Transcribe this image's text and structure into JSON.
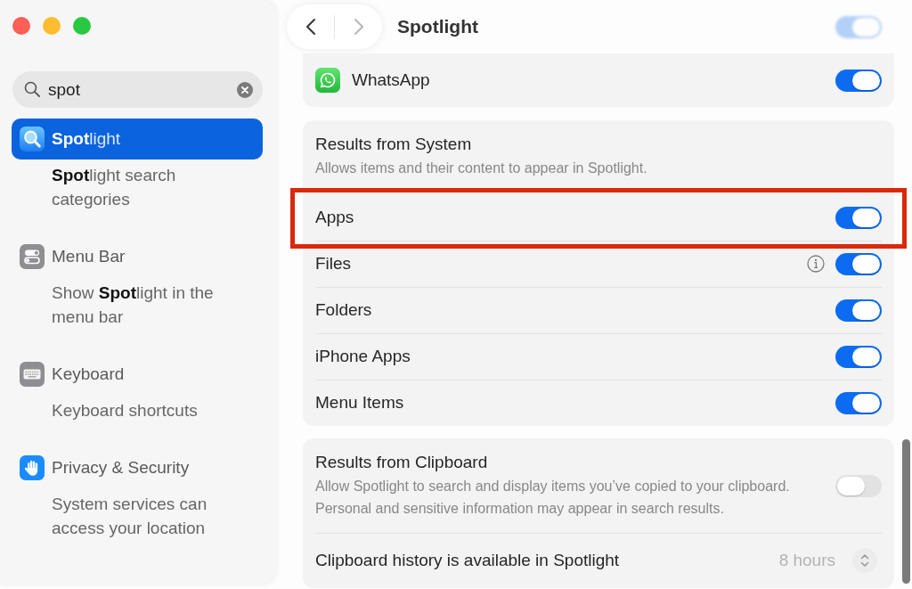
{
  "sidebar": {
    "search": {
      "value": "spot"
    },
    "sections": [
      {
        "kind": "spotlight",
        "label": "**Spot**light",
        "selected": true,
        "results": [
          "**Spot**light search categories"
        ]
      },
      {
        "kind": "menu-bar",
        "label": "Menu Bar",
        "selected": false,
        "results": [
          "Show **Spot**light in the menu bar"
        ]
      },
      {
        "kind": "keyboard",
        "label": "Keyboard",
        "selected": false,
        "results": [
          "Keyboard shortcuts"
        ]
      },
      {
        "kind": "privacy",
        "label": "Privacy & Security",
        "selected": false,
        "results": [
          "System services can access your location"
        ]
      }
    ]
  },
  "toolbar": {
    "back": {
      "disabled": false
    },
    "forward": {
      "disabled": true
    },
    "title": "Spotlight",
    "faded_toggle": {
      "on": true
    }
  },
  "app_rows": [
    {
      "label": "WhatsApp",
      "on": true
    }
  ],
  "system_results": {
    "title": "Results from System",
    "description": "Allows items and their content to appear in Spotlight.",
    "rows": [
      {
        "label": "Apps",
        "info": false,
        "on": true,
        "highlighted": true
      },
      {
        "label": "Files",
        "info": true,
        "on": true,
        "highlighted": false
      },
      {
        "label": "Folders",
        "info": false,
        "on": true,
        "highlighted": false
      },
      {
        "label": "iPhone Apps",
        "info": false,
        "on": true,
        "highlighted": false
      },
      {
        "label": "Menu Items",
        "info": false,
        "on": true,
        "highlighted": false
      }
    ]
  },
  "clipboard": {
    "title": "Results from Clipboard",
    "description": "Allow Spotlight to search and display items you’ve copied to your clipboard. Personal and sensitive information may appear in search results.",
    "on": false,
    "history": {
      "label": "Clipboard history is available in Spotlight",
      "value": "8 hours",
      "disabled": true
    }
  }
}
